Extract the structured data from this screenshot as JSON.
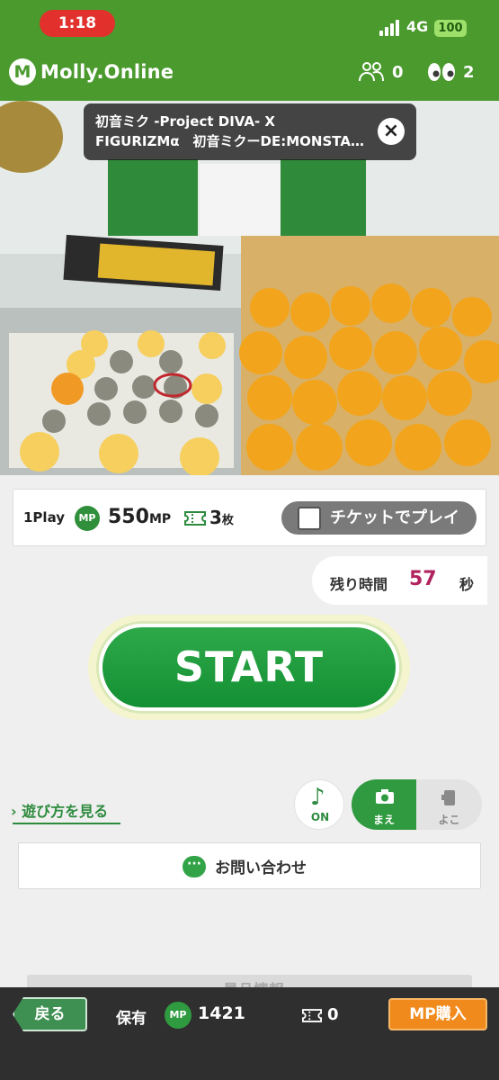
{
  "status_bar": {
    "time": "1:18",
    "network": "4G",
    "battery": "100"
  },
  "header": {
    "logo_text": "Molly.Online",
    "players_count": "0",
    "viewers_count": "2",
    "colors": {
      "brand_green": "#4b9a2e",
      "accent_orange": "#f08a1c"
    }
  },
  "camera": {
    "prize_line1": "初音ミク -Project DIVA- X",
    "prize_line2": "FIGURIZMα　初音ミクーDE:MONSTA…",
    "close_icon": "×"
  },
  "play": {
    "label": "1Play",
    "mp_badge": "MP",
    "cost": "550",
    "cost_unit": "MP",
    "tickets": "3",
    "tickets_unit": "枚",
    "ticket_toggle_label": "チケットでプレイ"
  },
  "timer": {
    "label": "残り時間",
    "value": "57",
    "unit": "秒"
  },
  "start_button": "START",
  "controls": {
    "howto": "遊び方を見る",
    "sound_label": "ON",
    "camera_front_label": "まえ",
    "camera_side_label": "よこ"
  },
  "contact_label": "お問い合わせ",
  "prize_info_peek": "景品情報",
  "bottom_bar": {
    "back_label": "戻る",
    "hold_label": "保有",
    "mp_badge": "MP",
    "mp_balance": "1421",
    "ticket_balance": "0",
    "buy_label": "MP購入"
  }
}
